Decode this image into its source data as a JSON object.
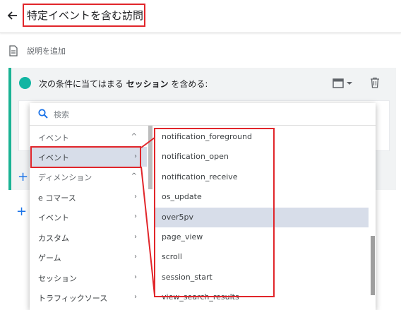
{
  "header": {
    "title": "特定イベントを含む訪問",
    "back_icon": "back-arrow-icon"
  },
  "description": {
    "label": "説明を追加",
    "icon": "document-icon"
  },
  "condition": {
    "prefix": "次の条件に当てはまる ",
    "bold": "セッション",
    "suffix": " を含める:",
    "accent_color": "#12b5a2"
  },
  "dropdown": {
    "search_placeholder": "検索",
    "left_items": [
      {
        "label": "イベント",
        "type": "header",
        "chevron": "^"
      },
      {
        "label": "イベント",
        "type": "item",
        "chevron": "›",
        "selected": true
      },
      {
        "label": "ディメンション",
        "type": "header",
        "chevron": "^"
      },
      {
        "label": "e コマース",
        "type": "item",
        "chevron": "›"
      },
      {
        "label": "イベント",
        "type": "item",
        "chevron": "›"
      },
      {
        "label": "カスタム",
        "type": "item",
        "chevron": "›"
      },
      {
        "label": "ゲーム",
        "type": "item",
        "chevron": "›"
      },
      {
        "label": "セッション",
        "type": "item",
        "chevron": "›"
      },
      {
        "label": "トラフィックソース",
        "type": "item",
        "chevron": "›"
      }
    ],
    "right_items": [
      {
        "label": "notification_foreground"
      },
      {
        "label": "notification_open"
      },
      {
        "label": "notification_receive"
      },
      {
        "label": "os_update"
      },
      {
        "label": "over5pv",
        "selected": true
      },
      {
        "label": "page_view"
      },
      {
        "label": "scroll"
      },
      {
        "label": "session_start"
      },
      {
        "label": "view_search_results"
      }
    ]
  },
  "colors": {
    "highlight": "#e1262b",
    "selected_bg": "#d7dde9",
    "accent": "#1a73e8"
  }
}
